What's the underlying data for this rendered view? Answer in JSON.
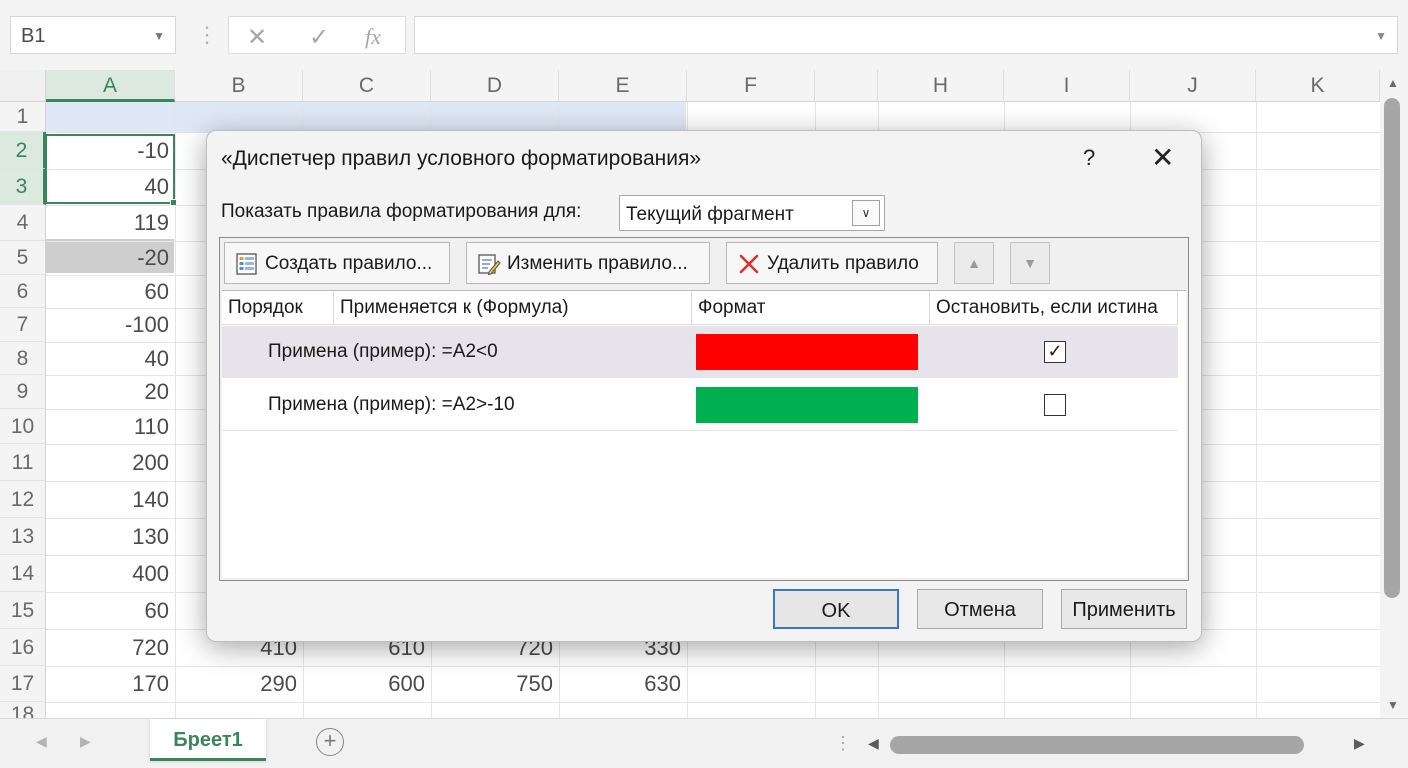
{
  "formula_bar": {
    "name_box": "B1",
    "cancel_glyph": "✕",
    "enter_glyph": "✓",
    "fx_glyph": "fx",
    "formula": ""
  },
  "grid": {
    "columns": [
      "A",
      "B",
      "C",
      "D",
      "E",
      "F",
      "",
      "H",
      "I",
      "J",
      "K"
    ],
    "rows": [
      "1",
      "2",
      "3",
      "4",
      "5",
      "6",
      "7",
      "8",
      "9",
      "10",
      "11",
      "12",
      "13",
      "14",
      "15",
      "16",
      "17",
      "18"
    ],
    "col_a_values": [
      "",
      "-10",
      "40",
      "119",
      "-20",
      "60",
      "-100",
      "40",
      "20",
      "110",
      "200",
      "140",
      "130",
      "400",
      "60",
      "720",
      "170"
    ],
    "row16_visible": [
      "410",
      "610",
      "720",
      "330"
    ],
    "row17_visible": [
      "290",
      "600",
      "750",
      "630"
    ]
  },
  "sheet_tabs": {
    "active": "Бреет1",
    "add_glyph": "+"
  },
  "dialog": {
    "title": "«Диспетчер правил условного форматирования»",
    "help_glyph": "?",
    "close_glyph": "✕",
    "show_label": "Показать правила форматирования для:",
    "show_value": "Текущий фрагмент",
    "toolbar": {
      "new_rule": "Создать правило...",
      "edit_rule": "Изменить правило...",
      "delete_rule": "Удалить правило"
    },
    "table": {
      "headers": [
        "Порядок",
        "Применяется к (Формула)",
        "Формат",
        "Остановить, если истина"
      ],
      "rows": [
        {
          "applies": "Примена (пример): =A2<0",
          "color": "#ff0000",
          "stop": true
        },
        {
          "applies": "Примена (пример): =A2>-10",
          "color": "#00b050",
          "stop": false
        }
      ]
    },
    "buttons": {
      "ok": "OK",
      "cancel": "Отмена",
      "apply": "Применить"
    }
  },
  "colors": {
    "excel_green": "#217346",
    "selection_band": "#dbe5f4",
    "ok_border": "#3a76c4"
  }
}
